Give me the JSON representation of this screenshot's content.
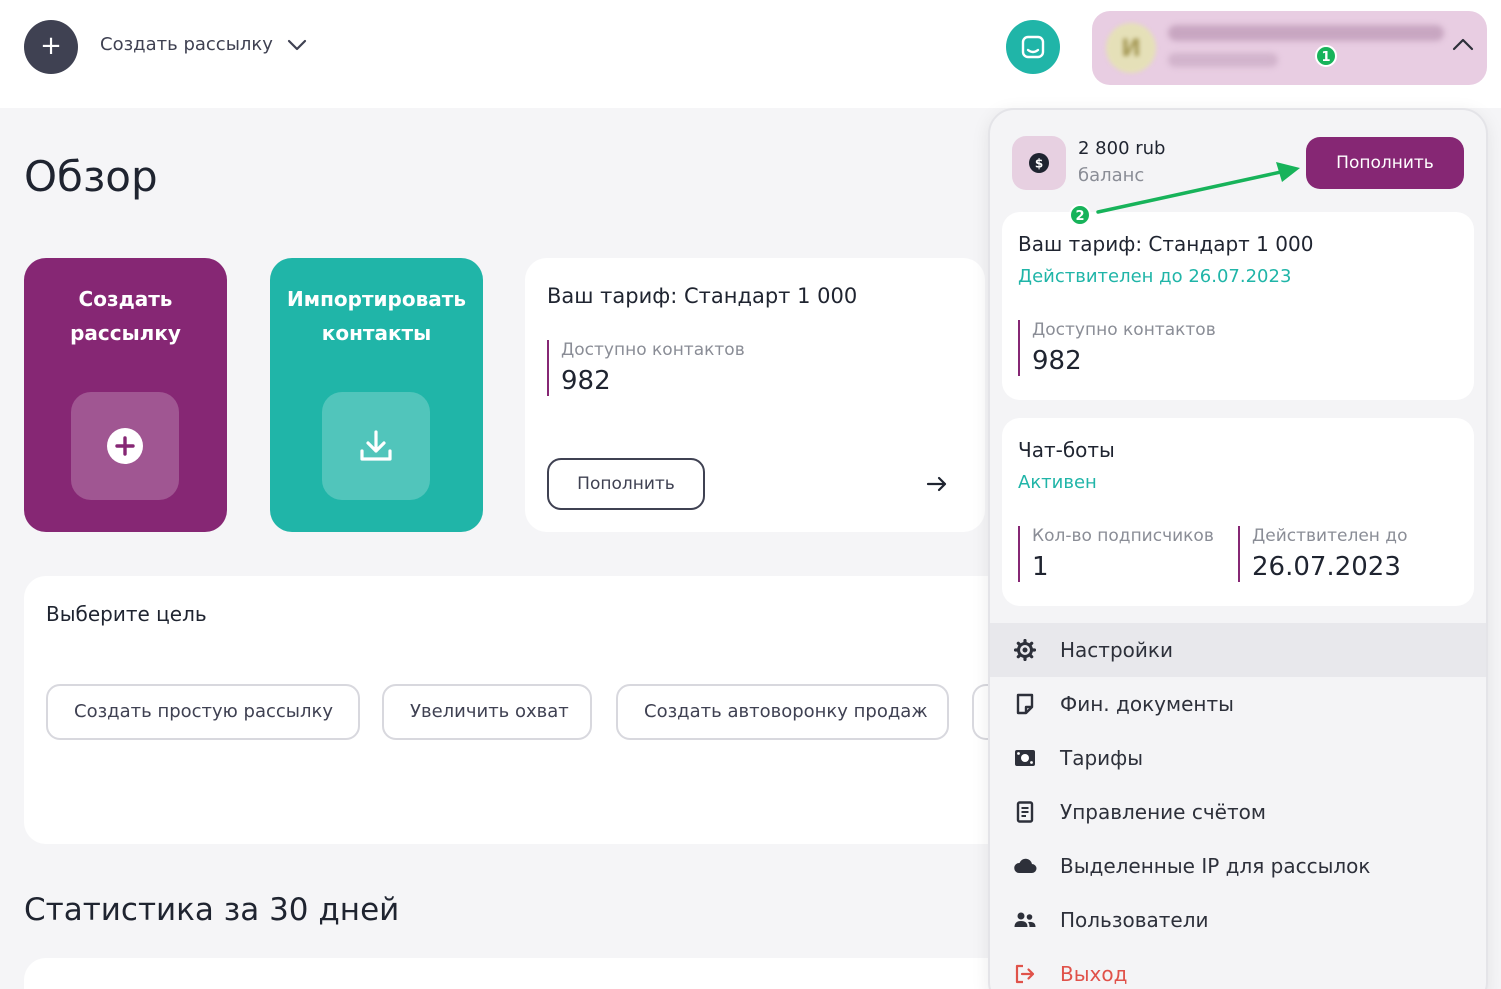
{
  "topbar": {
    "create_dropdown_label": "Создать рассылку",
    "account_avatar_letter": "И",
    "step1": "1"
  },
  "main": {
    "title": "Обзор",
    "card_create_label": "Создать рассылку",
    "card_import_label": "Импортировать контакты",
    "tariff": {
      "title": "Ваш тариф: Стандарт 1 000",
      "contacts_label": "Доступно контактов",
      "contacts_value": "982",
      "topup_label": "Пополнить"
    },
    "goal": {
      "title": "Выберите цель",
      "buttons": [
        "Создать простую рассылку",
        "Увеличить охват",
        "Создать автоворонку продаж"
      ]
    },
    "stats_title": "Статистика за 30 дней"
  },
  "dropdown": {
    "balance_amount": "2 800 rub",
    "balance_label": "баланс",
    "topup_label": "Пополнить",
    "step2": "2",
    "tariff": {
      "title": "Ваш тариф: Стандарт 1 000",
      "valid": "Действителен до 26.07.2023",
      "contacts_label": "Доступно контактов",
      "contacts_value": "982"
    },
    "chatbots": {
      "title": "Чат-боты",
      "status": "Активен",
      "subscribers_label": "Кол-во подписчиков",
      "subscribers_value": "1",
      "valid_label": "Действителен до",
      "valid_value": "26.07.2023"
    },
    "menu": [
      {
        "label": "Настройки",
        "icon": "gear-icon"
      },
      {
        "label": "Фин. документы",
        "icon": "document-icon"
      },
      {
        "label": "Тарифы",
        "icon": "tariff-icon"
      },
      {
        "label": "Управление счётом",
        "icon": "account-book-icon"
      },
      {
        "label": "Выделенные IP для рассылок",
        "icon": "cloud-icon"
      },
      {
        "label": "Пользователи",
        "icon": "users-icon"
      },
      {
        "label": "Выход",
        "icon": "logout-icon"
      }
    ]
  },
  "colors": {
    "brand_purple": "#862774",
    "brand_teal": "#20b5a8",
    "annotation_green": "#17b35a",
    "logout_red": "#e0524a"
  }
}
